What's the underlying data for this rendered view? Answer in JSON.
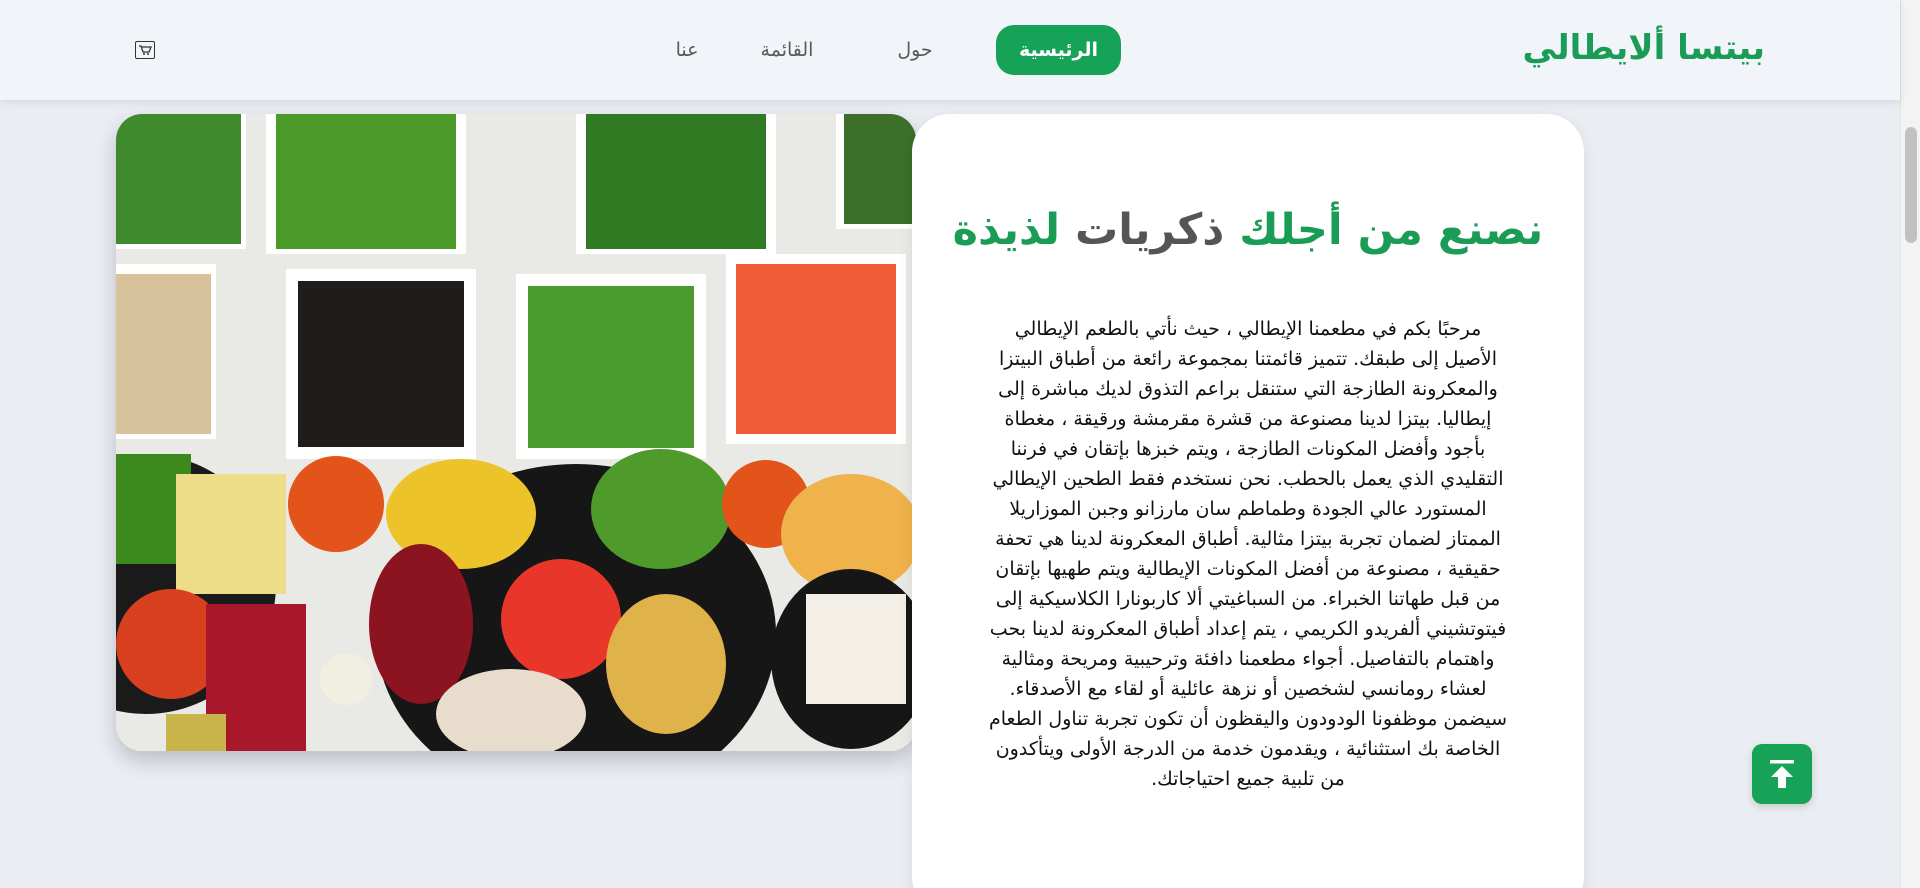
{
  "brand": "بيتسا ألايطالي",
  "nav": {
    "home": "الرئيسية",
    "about": "حول",
    "menu": "القائمة",
    "us": "عنا"
  },
  "icons": {
    "cart": "cart-icon",
    "scroll_top": "arrow-up-icon"
  },
  "colors": {
    "accent": "#16a257",
    "title_green": "#1a9c56",
    "title_grey": "#555555"
  },
  "hero": {
    "title_part1": "نصنع من ",
    "title_part2": "أجلك",
    "title_part3": " ذكريات ",
    "title_part4": "لذيذة",
    "body": "مرحبًا بكم في مطعمنا الإيطالي ، حيث نأتي بالطعم الإيطالي الأصيل إلى طبقك. تتميز قائمتنا بمجموعة رائعة من أطباق البيتزا والمعكرونة الطازجة التي ستنقل براعم التذوق لديك مباشرة إلى إيطاليا. بيتزا لدينا مصنوعة من قشرة مقرمشة ورقيقة ، مغطاة بأجود وأفضل المكونات الطازجة ، ويتم خبزها بإتقان في فرننا التقليدي الذي يعمل بالحطب. نحن نستخدم فقط الطحين الإيطالي المستورد عالي الجودة وطماطم سان مارزانو وجبن الموزاريلا الممتاز لضمان تجربة بيتزا مثالية. أطباق المعكرونة لدينا هي تحفة حقيقية ، مصنوعة من أفضل المكونات الإيطالية ويتم طهيها بإتقان من قبل طهاتنا الخبراء. من السباغيتي ألا كاربونارا الكلاسيكية إلى فيتوتشيني ألفريدو الكريمي ، يتم إعداد أطباق المعكرونة لدينا بحب واهتمام بالتفاصيل. أجواء مطعمنا دافئة وترحيبية ومريحة ومثالية لعشاء رومانسي لشخصين أو نزهة عائلية أو لقاء مع الأصدقاء. سيضمن موظفونا الودودون واليقظون أن تكون تجربة تناول الطعام الخاصة بك استثنائية ، ويقدمون خدمة من الدرجة الأولى ويتأكدون من تلبية جميع احتياجاتك."
  }
}
